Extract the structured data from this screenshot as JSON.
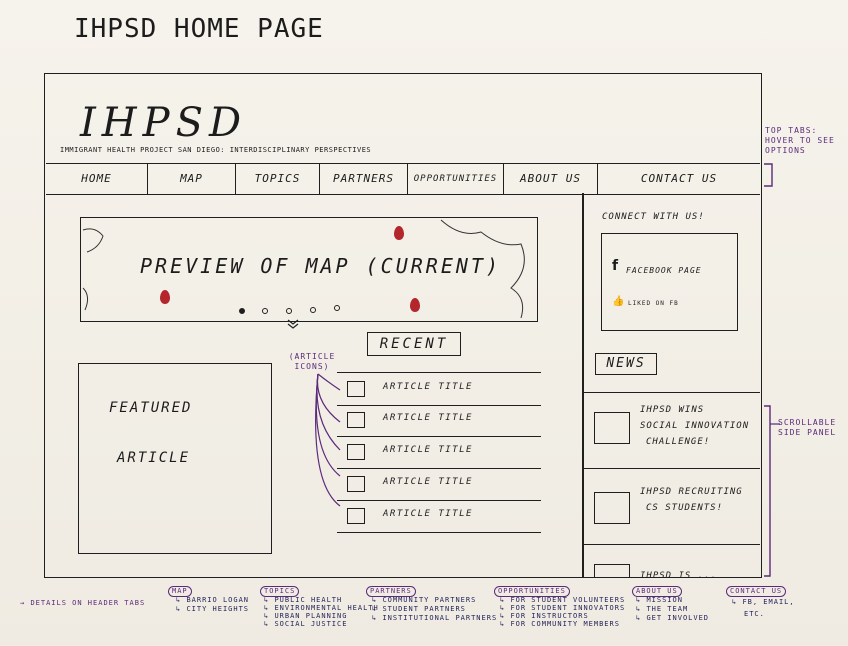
{
  "page_title": "IHPSD HOME PAGE",
  "site": {
    "logo": "IHPSD",
    "subtitle": "IMMIGRANT HEALTH PROJECT SAN DIEGO: INTERDISCIPLINARY PERSPECTIVES"
  },
  "nav": [
    "HOME",
    "MAP",
    "TOPICS",
    "PARTNERS",
    "OPPORTUNITIES",
    "ABOUT US",
    "CONTACT US"
  ],
  "annotations": {
    "top_tabs": "TOP TABS: HOVER TO SEE OPTIONS",
    "scrollable": "SCROLLABLE SIDE PANEL",
    "article_icons": "(ARTICLE ICONS)",
    "details": "DETAILS ON HEADER TABS"
  },
  "map_preview": {
    "label": "PREVIEW OF MAP (CURRENT)",
    "carousel_dots": 5,
    "active_dot": 0
  },
  "recent": {
    "heading": "RECENT",
    "articles": [
      "ARTICLE TITLE",
      "ARTICLE TITLE",
      "ARTICLE TITLE",
      "ARTICLE TITLE",
      "ARTICLE TITLE"
    ]
  },
  "featured": {
    "line1": "FEATURED",
    "line2": "ARTICLE"
  },
  "side": {
    "connect": "CONNECT WITH US!",
    "fb_page": "FACEBOOK PAGE",
    "fb_liked": "LIKED ON FB",
    "news_heading": "NEWS",
    "news": [
      {
        "l1": "IHPSD WINS",
        "l2": "SOCIAL INNOVATION",
        "l3": "CHALLENGE!"
      },
      {
        "l1": "IHPSD RECRUITING",
        "l2": "CS STUDENTS!",
        "l3": ""
      },
      {
        "l1": "IHPSD IS ...",
        "l2": "",
        "l3": ""
      }
    ]
  },
  "sitemap": [
    {
      "head": "MAP",
      "items": [
        "BARRIO LOGAN",
        "CITY HEIGHTS"
      ]
    },
    {
      "head": "TOPICS",
      "items": [
        "PUBLIC HEALTH",
        "ENVIRONMENTAL HEALTH",
        "URBAN PLANNING",
        "SOCIAL JUSTICE"
      ]
    },
    {
      "head": "PARTNERS",
      "items": [
        "COMMUNITY PARTNERS",
        "STUDENT PARTNERS",
        "INSTITUTIONAL PARTNERS"
      ]
    },
    {
      "head": "OPPORTUNITIES",
      "items": [
        "FOR STUDENT VOLUNTEERS",
        "FOR STUDENT INNOVATORS",
        "FOR INSTRUCTORS",
        "FOR COMMUNITY MEMBERS"
      ]
    },
    {
      "head": "ABOUT US",
      "items": [
        "MISSION",
        "THE TEAM",
        "GET INVOLVED"
      ]
    },
    {
      "head": "CONTACT US",
      "items": [
        "FB, EMAIL,",
        "ETC."
      ]
    }
  ],
  "colors": {
    "ink": "#1f1f1f",
    "annotation": "#5b2a7a",
    "pin": "#b3262b"
  }
}
